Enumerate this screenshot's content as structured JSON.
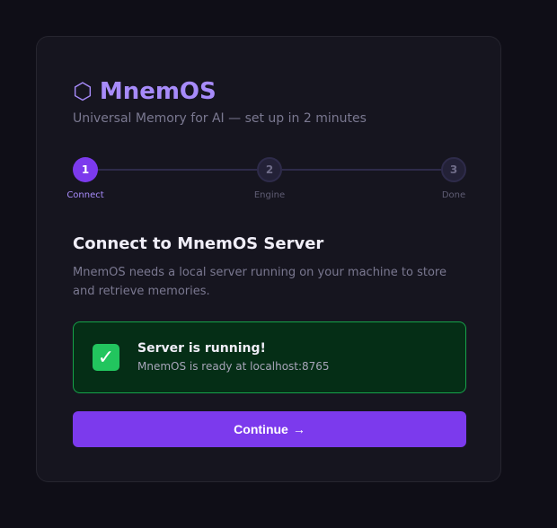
{
  "brand": {
    "icon": "hexagon-icon",
    "icon_glyph": "⬡",
    "name": "MnemOS",
    "tagline": "Universal Memory for AI — set up in 2 minutes"
  },
  "stepper": {
    "steps": [
      {
        "number": "1",
        "label": "Connect",
        "state": "active"
      },
      {
        "number": "2",
        "label": "Engine",
        "state": "inactive"
      },
      {
        "number": "3",
        "label": "Done",
        "state": "inactive"
      }
    ]
  },
  "section": {
    "title": "Connect to MnemOS Server",
    "description": "MnemOS needs a local server running on your machine to store and retrieve memories."
  },
  "status": {
    "icon": "check-icon",
    "icon_glyph": "✓",
    "title": "Server is running!",
    "detail": "MnemOS is ready at localhost:8765"
  },
  "actions": {
    "continue_label": "Continue",
    "continue_arrow": "→"
  },
  "colors": {
    "accent": "#7c3aed",
    "brand": "#a78bfa",
    "success_bg": "#052e16",
    "success_border": "#16a34a",
    "success_icon": "#22c55e"
  }
}
